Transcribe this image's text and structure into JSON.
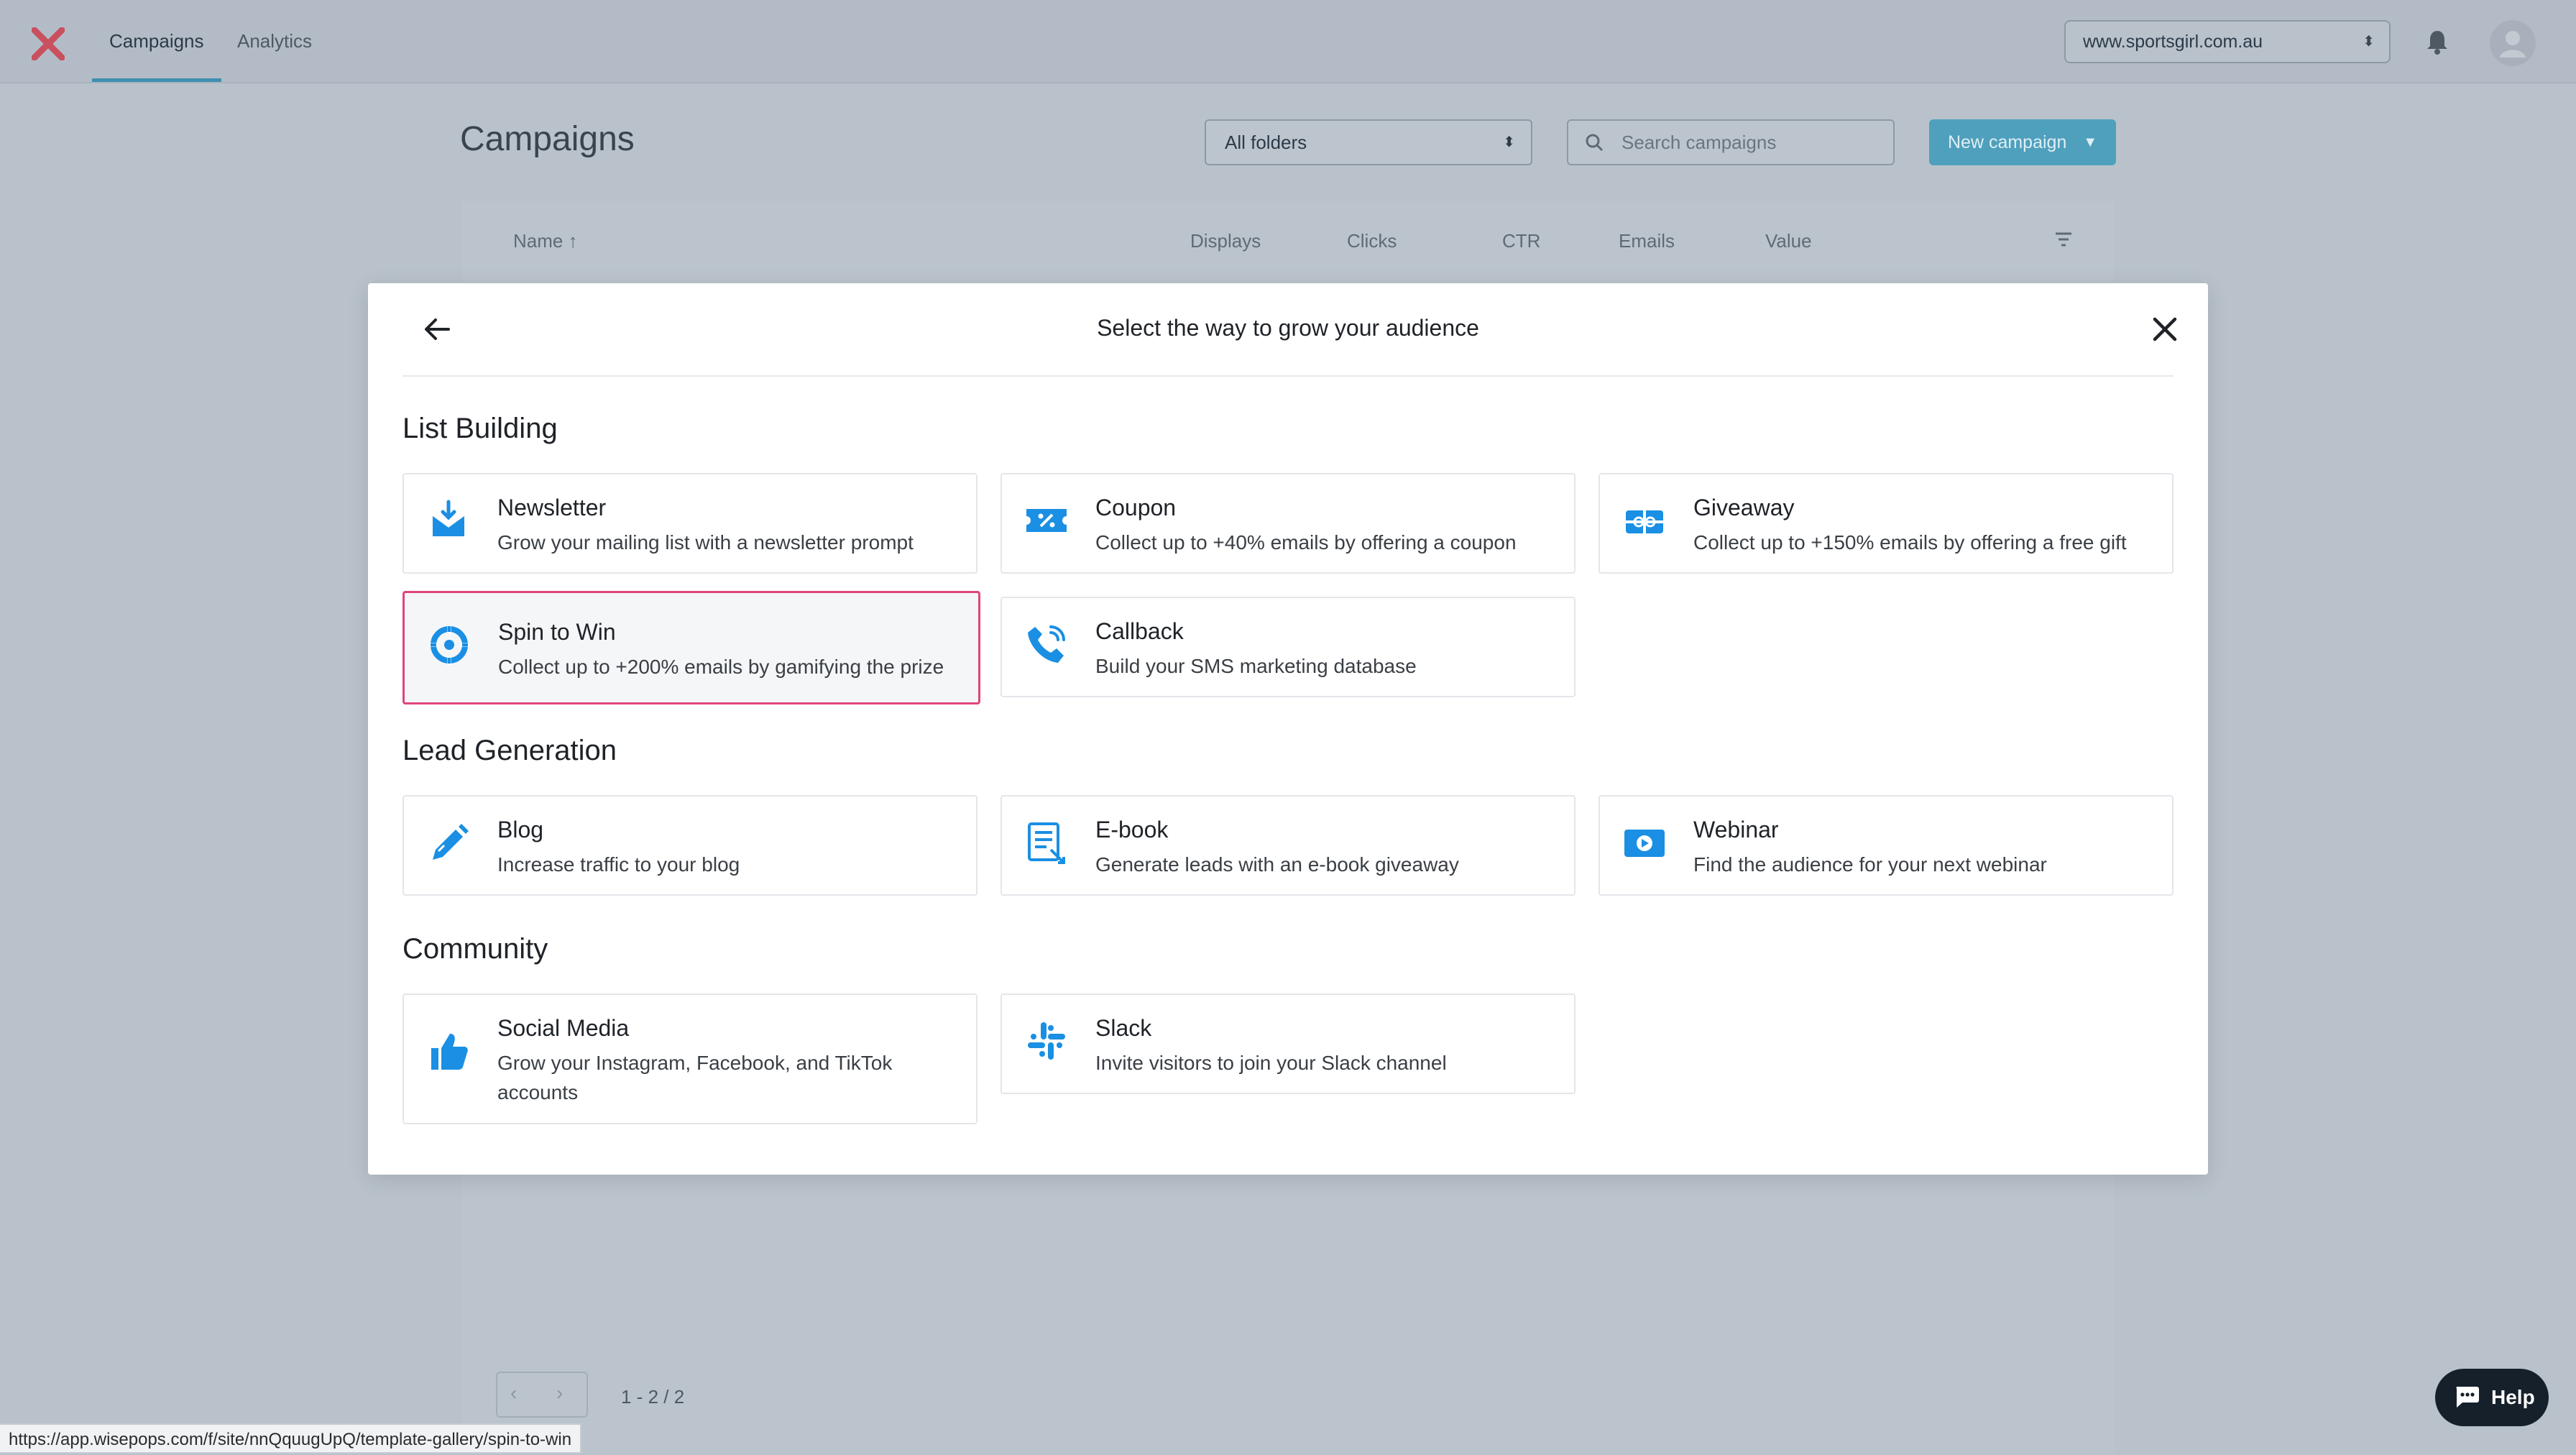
{
  "app": {
    "tabs": [
      {
        "label": "Campaigns",
        "active": true
      },
      {
        "label": "Analytics",
        "active": false
      }
    ],
    "site_select": "www.sportsgirl.com.au",
    "page_title": "Campaigns",
    "folder_select": "All folders",
    "search_placeholder": "Search campaigns",
    "new_campaign_label": "New campaign",
    "table_headers": [
      "Name ↑",
      "Displays",
      "Clicks",
      "CTR",
      "Emails",
      "Value"
    ],
    "pagination": "1 - 2 / 2",
    "status_url": "https://app.wisepops.com/f/site/nnQquugUpQ/template-gallery/spin-to-win",
    "help_label": "Help"
  },
  "modal": {
    "title": "Select the way to grow your audience",
    "sections": [
      {
        "title": "List Building",
        "cards": [
          {
            "icon": "newsletter-icon",
            "title": "Newsletter",
            "desc": "Grow your mailing list with a newsletter prompt"
          },
          {
            "icon": "coupon-icon",
            "title": "Coupon",
            "desc": "Collect up to +40% emails by offering a coupon"
          },
          {
            "icon": "giveaway-icon",
            "title": "Giveaway",
            "desc": "Collect up to +150% emails by offering a free gift"
          },
          {
            "icon": "spin-wheel-icon",
            "title": "Spin to Win",
            "desc": "Collect up to +200% emails by gamifying the prize",
            "selected": true
          },
          {
            "icon": "phone-icon",
            "title": "Callback",
            "desc": "Build your SMS marketing database"
          }
        ]
      },
      {
        "title": "Lead Generation",
        "cards": [
          {
            "icon": "pen-icon",
            "title": "Blog",
            "desc": "Increase traffic to your blog"
          },
          {
            "icon": "ebook-icon",
            "title": "E-book",
            "desc": "Generate leads with an e-book giveaway"
          },
          {
            "icon": "video-icon",
            "title": "Webinar",
            "desc": "Find the audience for your next webinar"
          }
        ]
      },
      {
        "title": "Community",
        "cards": [
          {
            "icon": "thumbs-up-icon",
            "title": "Social Media",
            "desc": "Grow your Instagram, Facebook, and TikTok accounts"
          },
          {
            "icon": "slack-icon",
            "title": "Slack",
            "desc": "Invite visitors to join your Slack channel"
          }
        ]
      }
    ]
  },
  "colors": {
    "accent": "#1a8fe3",
    "selected_border": "#e0457a",
    "overlay": "#b9c2cb",
    "button": "#4fa0bd"
  }
}
